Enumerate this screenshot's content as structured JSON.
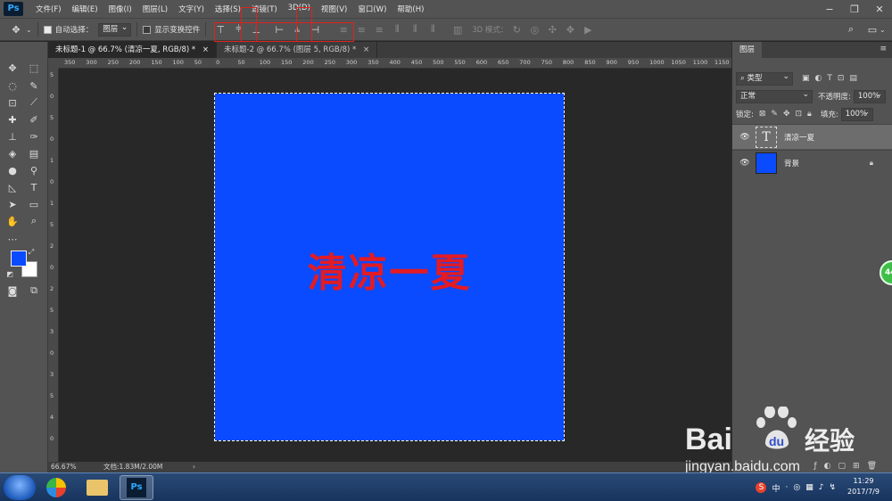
{
  "app": {
    "logo": "Ps"
  },
  "menu": [
    "文件(F)",
    "编辑(E)",
    "图像(I)",
    "图层(L)",
    "文字(Y)",
    "选择(S)",
    "滤镜(T)",
    "3D(D)",
    "视图(V)",
    "窗口(W)",
    "帮助(H)"
  ],
  "options": {
    "auto_select_label": "自动选择：",
    "auto_select_value": "图层",
    "show_transform_label": "显示变换控件",
    "mode_3d_label": "3D 模式："
  },
  "tabs": [
    {
      "label": "未标题-1 @ 66.7% (清凉一夏, RGB/8) *",
      "close": "×"
    },
    {
      "label": "未标题-2 @ 66.7% (图层 5, RGB/8) *",
      "close": "×"
    }
  ],
  "ruler": {
    "h": [
      "350",
      "300",
      "250",
      "200",
      "150",
      "100",
      "50",
      "0",
      "50",
      "100",
      "150",
      "200",
      "250",
      "300",
      "350",
      "400",
      "450",
      "500",
      "550",
      "600",
      "650",
      "700",
      "750",
      "800",
      "850",
      "900",
      "950",
      "1000",
      "1050",
      "1100",
      "1150"
    ],
    "v": [
      "5",
      "0",
      "5",
      "0",
      "1",
      "0",
      "1",
      "5",
      "2",
      "0",
      "2",
      "5",
      "3",
      "0",
      "3",
      "5",
      "4",
      "0"
    ]
  },
  "canvas": {
    "text": "清凉一夏",
    "bg_color": "#0a4bff",
    "text_color": "#e31b23"
  },
  "status": {
    "zoom": "66.67%",
    "doc": "文档:1.83M/2.00M",
    "arrow": "›"
  },
  "layers_panel": {
    "tab": "图层",
    "filter_label": "类型",
    "blend_mode": "正常",
    "opacity_label": "不透明度:",
    "opacity_value": "100%",
    "lock_label": "锁定:",
    "fill_label": "填充:",
    "fill_value": "100%",
    "layers": [
      {
        "name": "清凉一夏",
        "type": "text",
        "thumb": "T",
        "selected": true
      },
      {
        "name": "背景",
        "type": "fill",
        "color": "#0a4bff",
        "locked": true
      }
    ]
  },
  "colors": {
    "foreground": "#0a4bff",
    "background": "#ffffff"
  },
  "taskbar": {
    "tray": [
      "S",
      "中",
      "·",
      "◎",
      "▦",
      "♪",
      "↯"
    ],
    "time": "11:29",
    "date": "2017/7/9"
  },
  "badge": "44",
  "watermark": {
    "brand": "Bai",
    "du": "du",
    "cn": "经验",
    "url": "jingyan.baidu.com"
  }
}
